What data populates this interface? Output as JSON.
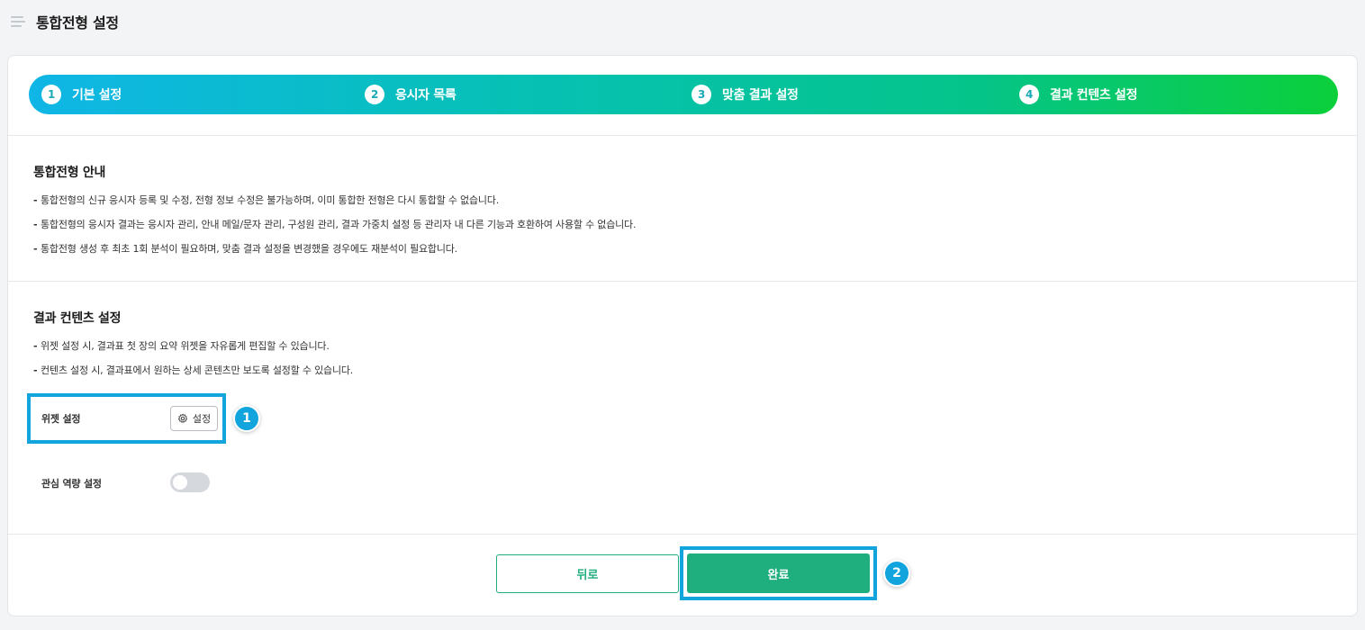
{
  "header": {
    "title": "통합전형 설정",
    "menu_icon": "menu-icon"
  },
  "stepper": {
    "steps": [
      {
        "num": "1",
        "label": "기본 설정"
      },
      {
        "num": "2",
        "label": "응시자 목록"
      },
      {
        "num": "3",
        "label": "맞춤 결과 설정"
      },
      {
        "num": "4",
        "label": "결과 컨텐츠 설정"
      }
    ],
    "gradient": [
      "#0fb6e6",
      "#06c1b4",
      "#05c48a",
      "#0bcf3a"
    ]
  },
  "guide": {
    "title": "통합전형 안내",
    "bullets": [
      "통합전형의 신규 응시자 등록 및 수정, 전형 정보 수정은 불가능하며, 이미 통합한 전형은 다시 통합할 수 없습니다.",
      "통합전형의 응시자 결과는 응시자 관리, 안내 메일/문자 관리, 구성원 관리, 결과 가중치 설정 등 관리자 내 다른 기능과 호환하여 사용할 수 없습니다.",
      "통합전형 생성 후 최초 1회 분석이 필요하며, 맞춤 결과 설정을 변경했을 경우에도 재분석이 필요합니다."
    ]
  },
  "content_settings": {
    "title": "결과 컨텐츠 설정",
    "bullets": [
      "위젯 설정 시, 결과표 첫 장의 요약 위젯을 자유롭게 편집할 수 있습니다.",
      "컨텐츠 설정 시, 결과표에서 원하는 상세 콘텐츠만 보도록 설정할 수 있습니다."
    ],
    "widget_label": "위젯 설정",
    "widget_button": "설정",
    "interest_label": "관심 역량 설정",
    "interest_toggle_on": false
  },
  "footer": {
    "back_label": "뒤로",
    "done_label": "완료"
  },
  "callouts": {
    "first": "1",
    "second": "2"
  },
  "colors": {
    "accent_green": "#1fae7d",
    "highlight_blue": "#12a4dd"
  }
}
